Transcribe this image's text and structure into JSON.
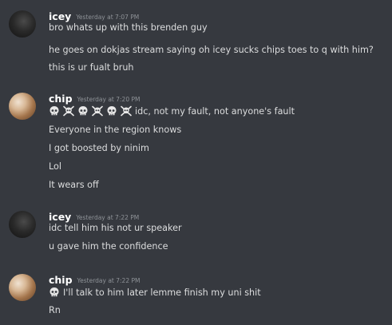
{
  "messages": [
    {
      "author": "icey",
      "timestamp": "Yesterday at 7:07 PM",
      "avatar_icon": "dark-avatar",
      "lines": [
        "bro whats up with this brenden guy",
        "he goes on dokjas stream saying oh icey sucks chips toes to q with him?",
        "this is ur fualt bruh"
      ]
    },
    {
      "author": "chip",
      "timestamp": "Yesterday at 7:20 PM",
      "avatar_icon": "photo-avatar",
      "first_line_emojis": [
        "skull",
        "skull-crossbones",
        "skull",
        "skull-crossbones",
        "skull",
        "skull-crossbones"
      ],
      "lines": [
        "idc, not my fault, not anyone's fault",
        "Everyone in the region knows",
        "I got boosted by ninim",
        "Lol",
        "It wears off"
      ]
    },
    {
      "author": "icey",
      "timestamp": "Yesterday at 7:22 PM",
      "avatar_icon": "dark-avatar",
      "lines": [
        "idc tell him his not ur speaker",
        "u gave him the confidence"
      ]
    },
    {
      "author": "chip",
      "timestamp": "Yesterday at 7:22 PM",
      "avatar_icon": "photo-avatar",
      "first_line_emojis": [
        "skull"
      ],
      "lines": [
        "I'll talk to him later lemme finish my uni shit",
        "Rn"
      ]
    }
  ]
}
